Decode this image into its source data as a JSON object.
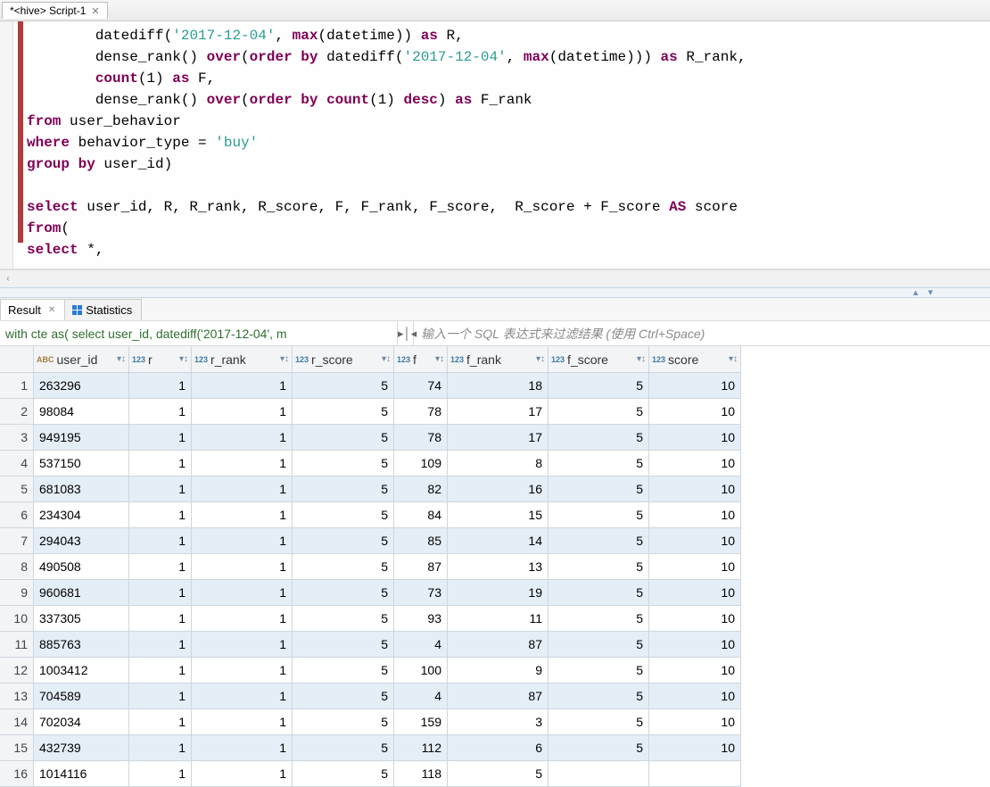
{
  "editor_tab": {
    "label": "*<hive> Script-1"
  },
  "code": {
    "l1_pre": "        datediff(",
    "l1_s1": "'2017-12-04'",
    "l1_mid": ", ",
    "l1_kw1": "max",
    "l1_post": "(datetime)) ",
    "l1_kw2": "as",
    "l1_end": " R,",
    "l2_pre": "        dense_rank() ",
    "l2_k1": "over",
    "l2_m1": "(",
    "l2_k2": "order by",
    "l2_m2": " datediff(",
    "l2_s1": "'2017-12-04'",
    "l2_m3": ", ",
    "l2_k3": "max",
    "l2_m4": "(datetime))) ",
    "l2_k4": "as",
    "l2_end": " R_rank,",
    "l3_pre": "        ",
    "l3_k1": "count",
    "l3_m1": "(1) ",
    "l3_k2": "as",
    "l3_end": " F,",
    "l4_pre": "        dense_rank() ",
    "l4_k1": "over",
    "l4_m1": "(",
    "l4_k2": "order by",
    "l4_m2": " ",
    "l4_k3": "count",
    "l4_m3": "(1) ",
    "l4_k4": "desc",
    "l4_m4": ") ",
    "l4_k5": "as",
    "l4_end": " F_rank",
    "l5_k1": "from",
    "l5_end": " user_behavior",
    "l6_k1": "where",
    "l6_m1": " behavior_type = ",
    "l6_s1": "'buy'",
    "l7_k1": "group by",
    "l7_end": " user_id)",
    "l8": "",
    "l9_k1": "select",
    "l9_m1": " user_id, R, R_rank, R_score, F, F_rank, F_score,  R_score + F_score ",
    "l9_k2": "AS",
    "l9_end": " score",
    "l10_k1": "from",
    "l10_end": "(",
    "l11_k1": "select",
    "l11_end": " *,"
  },
  "result_tabs": {
    "result": "Result",
    "stats": "Statistics"
  },
  "query_bar": {
    "left": "with cte as( select user_id, datediff('2017-12-04', m",
    "right": "输入一个 SQL 表达式来过滤结果 (使用 Ctrl+Space)"
  },
  "columns": [
    {
      "name": "user_id",
      "type": "abc"
    },
    {
      "name": "r",
      "type": "123"
    },
    {
      "name": "r_rank",
      "type": "123"
    },
    {
      "name": "r_score",
      "type": "123"
    },
    {
      "name": "f",
      "type": "123"
    },
    {
      "name": "f_rank",
      "type": "123"
    },
    {
      "name": "f_score",
      "type": "123"
    },
    {
      "name": "score",
      "type": "123"
    }
  ],
  "chart_data": {
    "type": "table",
    "columns": [
      "user_id",
      "r",
      "r_rank",
      "r_score",
      "f",
      "f_rank",
      "f_score",
      "score"
    ],
    "rows": [
      [
        "263296",
        1,
        1,
        5,
        74,
        18,
        5,
        10
      ],
      [
        "98084",
        1,
        1,
        5,
        78,
        17,
        5,
        10
      ],
      [
        "949195",
        1,
        1,
        5,
        78,
        17,
        5,
        10
      ],
      [
        "537150",
        1,
        1,
        5,
        109,
        8,
        5,
        10
      ],
      [
        "681083",
        1,
        1,
        5,
        82,
        16,
        5,
        10
      ],
      [
        "234304",
        1,
        1,
        5,
        84,
        15,
        5,
        10
      ],
      [
        "294043",
        1,
        1,
        5,
        85,
        14,
        5,
        10
      ],
      [
        "490508",
        1,
        1,
        5,
        87,
        13,
        5,
        10
      ],
      [
        "960681",
        1,
        1,
        5,
        73,
        19,
        5,
        10
      ],
      [
        "337305",
        1,
        1,
        5,
        93,
        11,
        5,
        10
      ],
      [
        "885763",
        1,
        1,
        5,
        4,
        87,
        5,
        10
      ],
      [
        "1003412",
        1,
        1,
        5,
        100,
        9,
        5,
        10
      ],
      [
        "704589",
        1,
        1,
        5,
        4,
        87,
        5,
        10
      ],
      [
        "702034",
        1,
        1,
        5,
        159,
        3,
        5,
        10
      ],
      [
        "432739",
        1,
        1,
        5,
        112,
        6,
        5,
        10
      ],
      [
        "1014116",
        1,
        1,
        5,
        118,
        5,
        null,
        null
      ]
    ]
  }
}
